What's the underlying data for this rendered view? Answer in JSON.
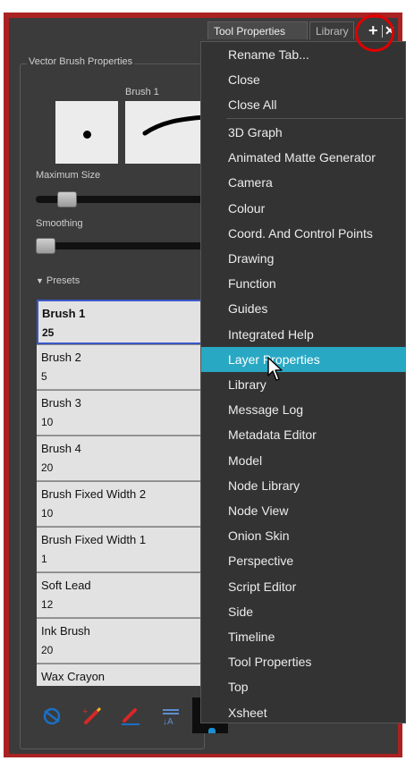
{
  "tabs": {
    "active": "Tool Properties",
    "inactive": "Library"
  },
  "tab_menu": {
    "plus_icon": "plus-icon",
    "close_icon": "close-x-icon"
  },
  "panel": {
    "group_title": "Vector Brush Properties",
    "brush_label": "Brush 1",
    "max_size_label": "Maximum Size",
    "smoothing_label": "Smoothing",
    "max_size_level": 0.14,
    "smoothing_level": 0.0,
    "presets_label": "Presets"
  },
  "presets": [
    {
      "name": "Brush 1",
      "size": "25"
    },
    {
      "name": "Brush 2",
      "size": "5"
    },
    {
      "name": "Brush 3",
      "size": "10"
    },
    {
      "name": "Brush 4",
      "size": "20"
    },
    {
      "name": "Brush Fixed Width 2",
      "size": "10"
    },
    {
      "name": "Brush Fixed Width 1",
      "size": "1"
    },
    {
      "name": "Soft Lead",
      "size": "12"
    },
    {
      "name": "Ink Brush",
      "size": "20"
    },
    {
      "name": "Wax Crayon",
      "size": ""
    }
  ],
  "selected_preset": "Brush 1",
  "toolbar_icons": [
    "new-preset-icon",
    "add-brush-icon",
    "edit-brush-icon",
    "import-export-icon"
  ],
  "menu": {
    "top_items": [
      "Rename Tab...",
      "Close",
      "Close All"
    ],
    "items": [
      "3D Graph",
      "Animated Matte Generator",
      "Camera",
      "Colour",
      "Coord. And Control Points",
      "Drawing",
      "Function",
      "Guides",
      "Integrated Help",
      "Layer Properties",
      "Library",
      "Message Log",
      "Metadata Editor",
      "Model",
      "Node Library",
      "Node View",
      "Onion Skin",
      "Perspective",
      "Script Editor",
      "Side",
      "Timeline",
      "Tool Properties",
      "Top",
      "Xsheet"
    ],
    "highlighted": "Layer Properties"
  },
  "colors": {
    "highlight": "#29a8c4",
    "selection_border": "#3a57c8",
    "annotation_circle": "#e10000",
    "frame": "#ab2222"
  }
}
